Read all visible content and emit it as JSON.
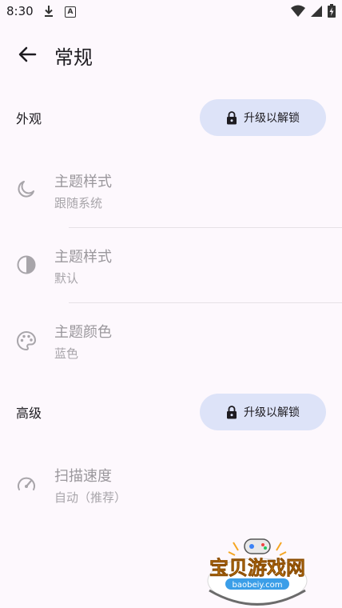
{
  "status": {
    "time": "8:30"
  },
  "header": {
    "title": "常规"
  },
  "sections": {
    "appearance": {
      "label": "外观",
      "unlock": "升级以解锁"
    },
    "advanced": {
      "label": "高级",
      "unlock": "升级以解锁"
    }
  },
  "items": {
    "theme_style_1": {
      "title": "主题样式",
      "subtitle": "跟随系统"
    },
    "theme_style_2": {
      "title": "主题样式",
      "subtitle": "默认"
    },
    "theme_color": {
      "title": "主题颜色",
      "subtitle": "蓝色"
    },
    "scan_speed": {
      "title": "扫描速度",
      "subtitle": "自动（推荐）"
    }
  },
  "watermark": {
    "brand": "宝贝游戏网",
    "domain": "baobeiy.com"
  },
  "colors": {
    "background": "#fdf8fd",
    "button_bg": "#dde3f8",
    "disabled_text": "#9a979c"
  }
}
